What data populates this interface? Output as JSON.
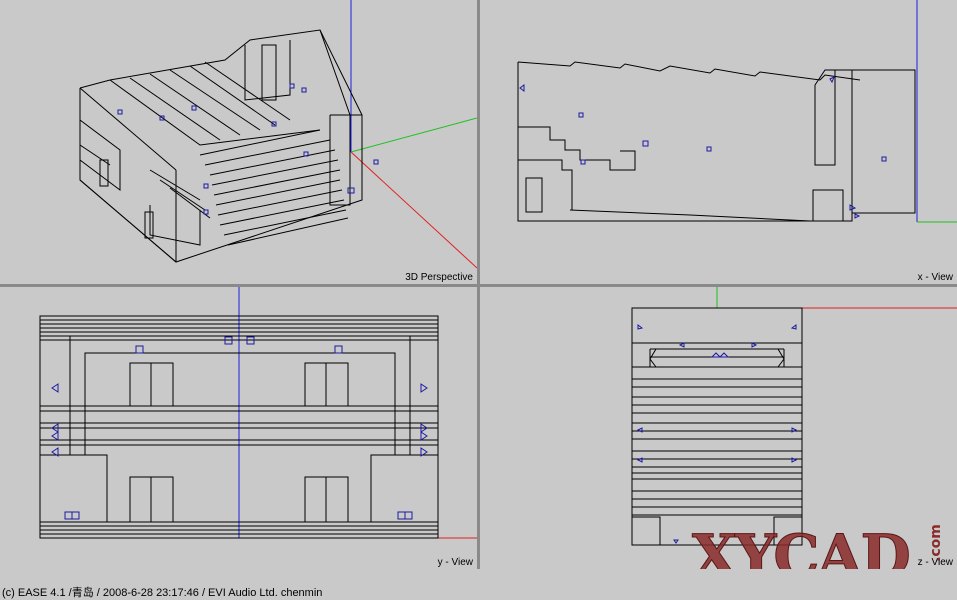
{
  "viewports": {
    "perspective": {
      "label": "3D Perspective"
    },
    "x_view": {
      "label": "x - View"
    },
    "y_view": {
      "label": "y - View"
    },
    "z_view": {
      "label": "z - View"
    }
  },
  "status": {
    "text": "(c) EASE 4.1 /青岛 / 2008-6-28 23:17:46 / EVI Audio Ltd. chenmin"
  },
  "watermark": {
    "text": "XYCAD",
    "suffix": ".com"
  },
  "colors": {
    "background": "#c9c9c9",
    "wireframe": "#000000",
    "axis_x": "#e02020",
    "axis_y": "#20c020",
    "axis_z": "#2020e0",
    "marker": "#1a1aa0",
    "watermark": "#8a2a2a"
  }
}
